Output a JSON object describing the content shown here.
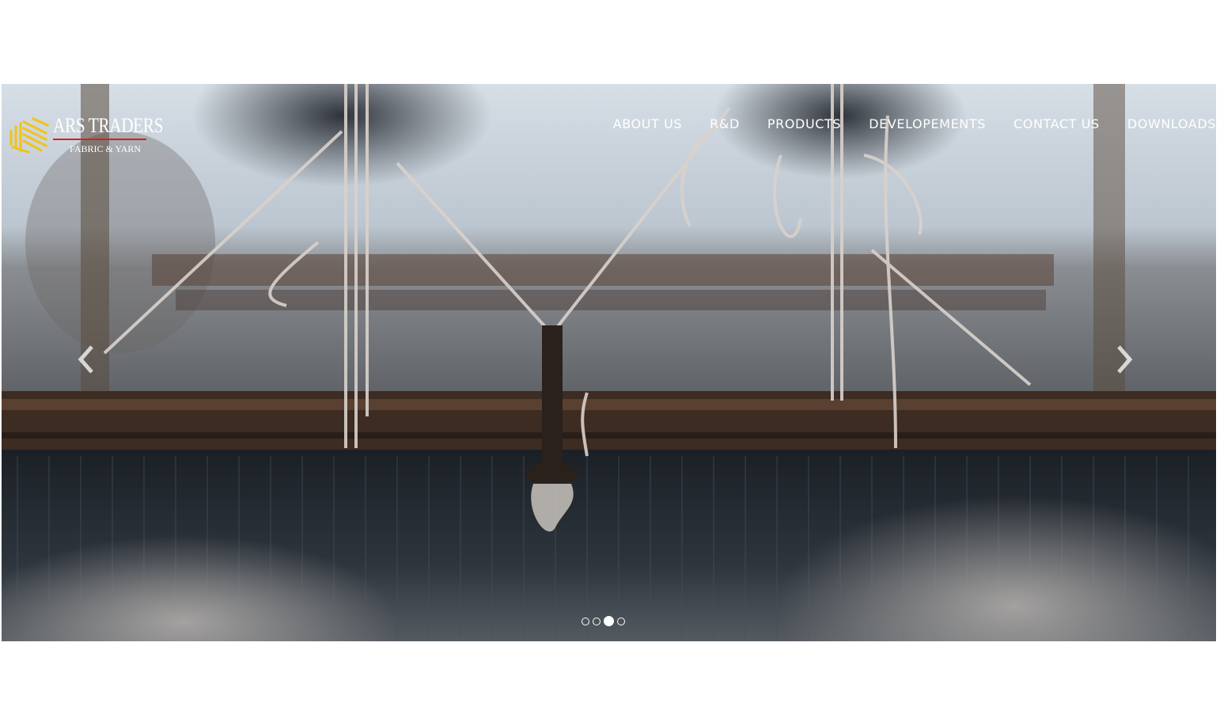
{
  "brand": {
    "name": "ARS TRADERS",
    "tagline": "FABRIC & YARN",
    "accent_color": "#d62020",
    "mark_color": "#f2c316"
  },
  "nav": {
    "items": [
      "ABOUT US",
      "R&D",
      "PRODUCTS",
      "DEVELOPEMENTS",
      "CONTACT US",
      "DOWNLOADS"
    ]
  },
  "carousel": {
    "prev_icon": "chevron-left-icon",
    "next_icon": "chevron-right-icon",
    "slide_count": 4,
    "active_index": 2
  }
}
